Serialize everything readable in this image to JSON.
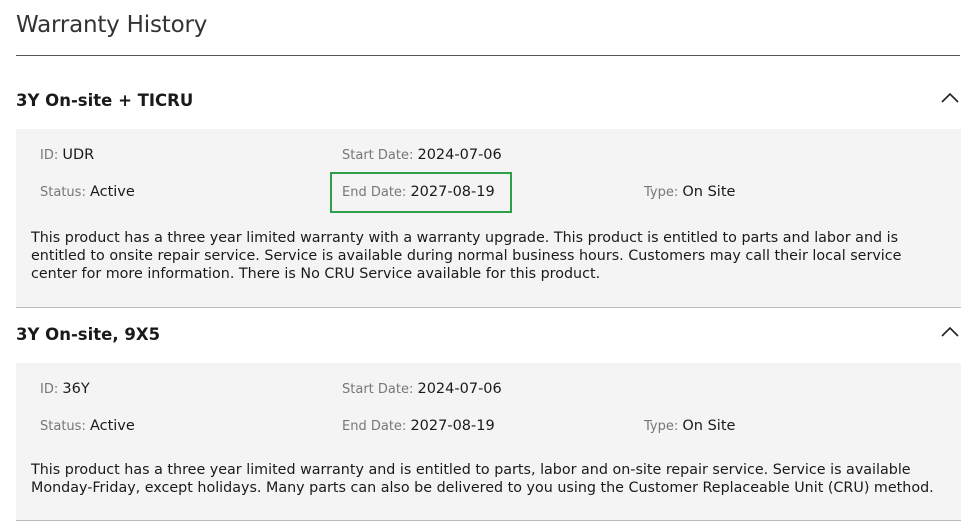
{
  "page": {
    "title": "Warranty History"
  },
  "labels": {
    "id": "ID",
    "start_date": "Start Date",
    "end_date": "End Date",
    "status": "Status",
    "type": "Type",
    "separator": ": "
  },
  "warranties": [
    {
      "name": "3Y On-site + TICRU",
      "id": "UDR",
      "start_date": "2024-07-06",
      "end_date": "2027-08-19",
      "status": "Active",
      "type": "On Site",
      "description": "This product has a three year limited warranty with a warranty upgrade. This product is entitled to parts and labor and is entitled to onsite repair service. Service is available during normal business hours. Customers may call their local service center for more information. There is No CRU Service available for this product.",
      "expanded": true
    },
    {
      "name": "3Y On-site, 9X5",
      "id": "36Y",
      "start_date": "2024-07-06",
      "end_date": "2027-08-19",
      "status": "Active",
      "type": "On Site",
      "description": "This product has a three year limited warranty and is entitled to parts, labor and on-site repair service. Service is available Monday-Friday, except holidays. Many parts can also be delivered to you using the Customer Replaceable Unit (CRU) method.",
      "expanded": true
    }
  ],
  "colors": {
    "highlight": "#2e9e4a",
    "panel_background": "#f4f4f4"
  },
  "icons": {
    "collapse": "chevron-up-icon"
  }
}
